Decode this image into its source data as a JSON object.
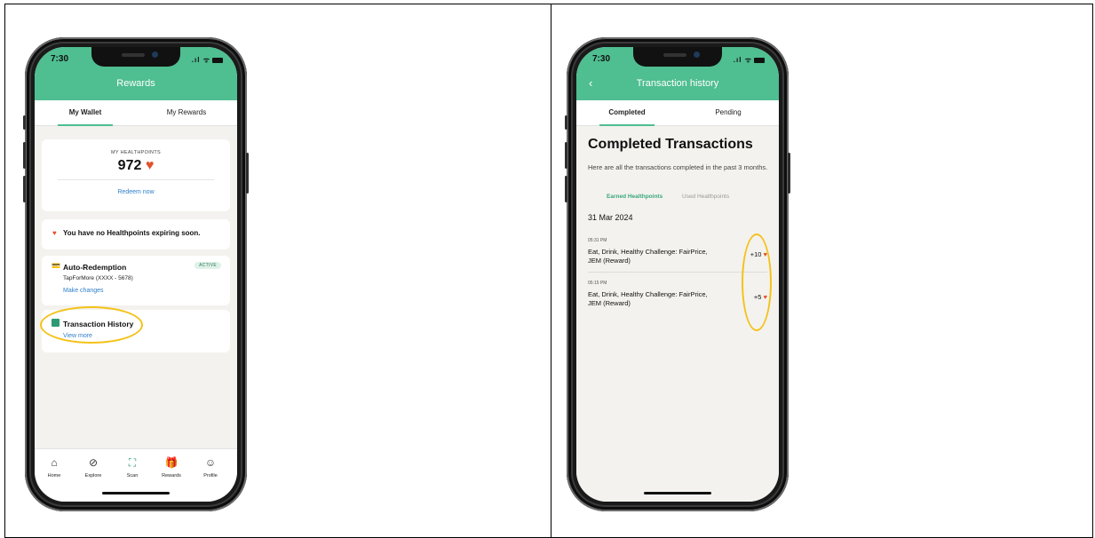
{
  "left_phone": {
    "status": {
      "time": "7:30"
    },
    "appbar": {
      "title": "Rewards"
    },
    "tabs": [
      "My Wallet",
      "My Rewards"
    ],
    "wallet": {
      "points_label": "MY HEALTHPOINTS",
      "points_value": "972",
      "redeem_label": "Redeem now"
    },
    "expiry_notice": "You have no Healthpoints expiring soon.",
    "auto_redemption": {
      "title": "Auto-Redemption",
      "badge": "ACTIVE",
      "account": "TapForMore (XXXX - 5678)",
      "link": "Make changes"
    },
    "transaction_history": {
      "title": "Transaction History",
      "link": "View more"
    },
    "nav": [
      {
        "label": "Home",
        "icon": "home-icon"
      },
      {
        "label": "Explore",
        "icon": "compass-icon"
      },
      {
        "label": "Scan",
        "icon": "scan-icon"
      },
      {
        "label": "Rewards",
        "icon": "gift-icon"
      },
      {
        "label": "Profile",
        "icon": "profile-icon"
      }
    ]
  },
  "right_phone": {
    "status": {
      "time": "7:30"
    },
    "appbar": {
      "title": "Transaction history"
    },
    "tabs": [
      "Completed",
      "Pending"
    ],
    "heading": "Completed Transactions",
    "description": "Here are all the transactions completed in the past 3 months.",
    "subtabs": [
      "Earned Healthpoints",
      "Used Healthpoints"
    ],
    "date": "31 Mar 2024",
    "transactions": [
      {
        "time": "05:31 PM",
        "desc": "Eat, Drink, Healthy Challenge: FairPrice, JEM (Reward)",
        "points": "+10"
      },
      {
        "time": "05:15 PM",
        "desc": "Eat, Drink, Healthy Challenge: FairPrice, JEM (Reward)",
        "points": "+5"
      }
    ]
  },
  "colors": {
    "brand_green": "#4fbe91",
    "heart": "#e2512a",
    "link_blue": "#2e7fc9",
    "highlight": "#f4c21a"
  }
}
